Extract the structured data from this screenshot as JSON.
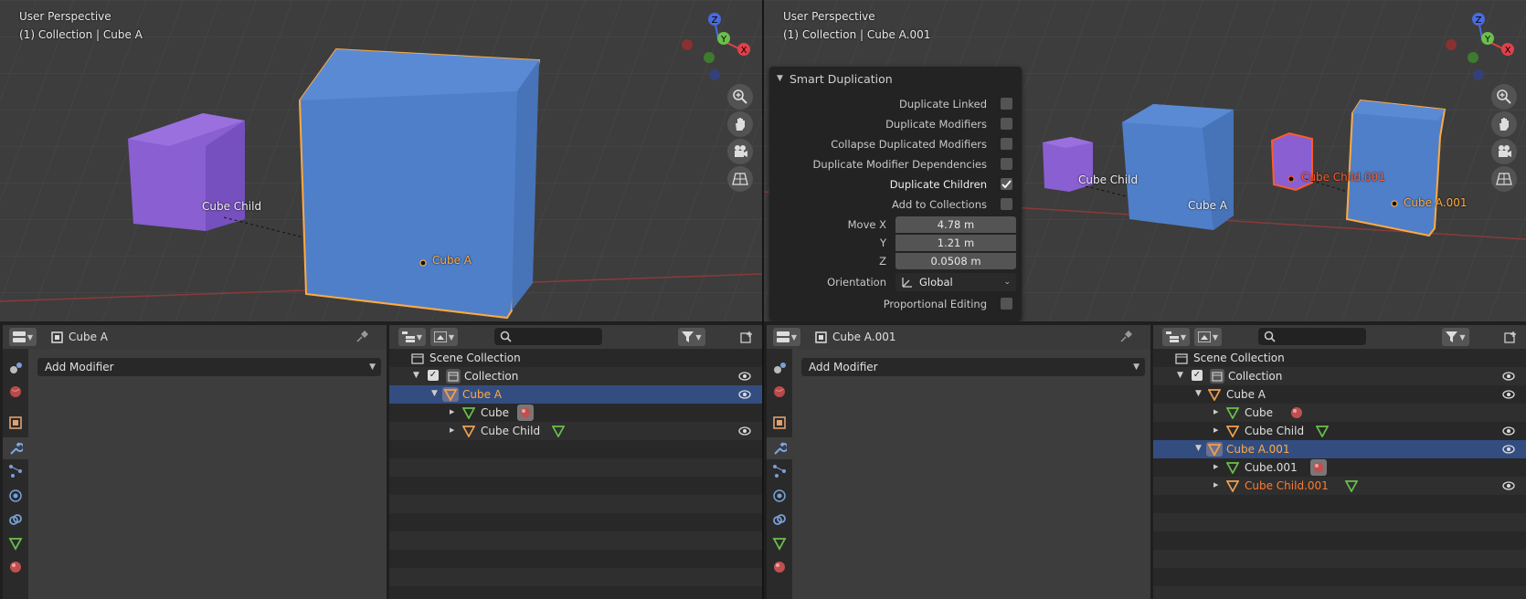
{
  "left": {
    "viewport": {
      "view_name": "User Perspective",
      "context": "(1) Collection | Cube A",
      "labels": {
        "child": "Cube Child",
        "parent": "Cube A"
      }
    },
    "properties": {
      "object_name": "Cube A",
      "add_modifier": "Add Modifier"
    },
    "outliner": {
      "scene_collection": "Scene Collection",
      "collection": "Collection",
      "rows": [
        {
          "label": "Cube A",
          "selected": true
        },
        {
          "label": "Cube"
        },
        {
          "label": "Cube Child"
        }
      ]
    }
  },
  "right": {
    "viewport": {
      "view_name": "User Perspective",
      "context": "(1) Collection | Cube A.001",
      "labels": {
        "child": "Cube Child",
        "parent": "Cube A",
        "child_copy": "Cube Child.001",
        "parent_copy": "Cube A.001"
      }
    },
    "smart_duplication": {
      "title": "Smart Duplication",
      "duplicate_linked": {
        "label": "Duplicate Linked",
        "checked": false
      },
      "duplicate_modifiers": {
        "label": "Duplicate Modifiers",
        "checked": false
      },
      "collapse_modifiers": {
        "label": "Collapse Duplicated Modifiers",
        "checked": false
      },
      "modifier_dependencies": {
        "label": "Duplicate Modifier Dependencies",
        "checked": false
      },
      "duplicate_children": {
        "label": "Duplicate Children",
        "checked": true
      },
      "add_to_collections": {
        "label": "Add to Collections",
        "checked": false
      },
      "move_x": {
        "label": "Move X",
        "value": "4.78 m"
      },
      "move_y": {
        "label": "Y",
        "value": "1.21 m"
      },
      "move_z": {
        "label": "Z",
        "value": "0.0508 m"
      },
      "orientation": {
        "label": "Orientation",
        "value": "Global"
      },
      "proportional_editing": {
        "label": "Proportional Editing",
        "checked": false
      }
    },
    "properties": {
      "object_name": "Cube A.001",
      "add_modifier": "Add Modifier"
    },
    "outliner": {
      "scene_collection": "Scene Collection",
      "collection": "Collection",
      "rows": [
        {
          "label": "Cube A"
        },
        {
          "label": "Cube"
        },
        {
          "label": "Cube Child"
        },
        {
          "label": "Cube A.001",
          "selected": true
        },
        {
          "label": "Cube.001"
        },
        {
          "label": "Cube Child.001"
        }
      ]
    }
  },
  "gizmo": {
    "x": "X",
    "y": "Y",
    "z": "Z"
  },
  "colors": {
    "selected_orange": "#ffaa40",
    "active_red": "#ff5a2a",
    "cube_blue": "#4f7fc9",
    "child_purple": "#8a5fd1",
    "outliner_selection": "#334d80",
    "axis_x": "#e0404a",
    "axis_y": "#6ac04a",
    "axis_z": "#4a6ae0"
  }
}
